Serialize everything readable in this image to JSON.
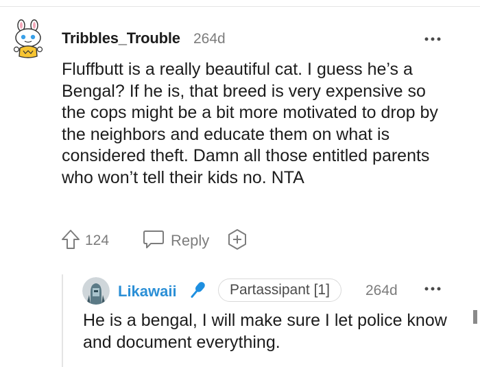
{
  "comment": {
    "username": "Tribbles_Trouble",
    "age": "264d",
    "body": "Fluffbutt is a really beautiful cat. I guess he’s a Bengal? If he is, that breed is very expensive so the cops might be a bit more motivated to drop by the neighbors and educate them on what is considered theft. Damn all those entitled parents who won’t tell their kids no. NTA",
    "upvotes": "124",
    "reply_label": "Reply",
    "more_icon": "ellipsis-icon"
  },
  "reply": {
    "username": "Likawaii",
    "flair": "Partassipant [1]",
    "age": "264d",
    "body": "He is a bengal, I will make sure I let police know and document everything.",
    "accent_color": "#2b8fd6"
  }
}
